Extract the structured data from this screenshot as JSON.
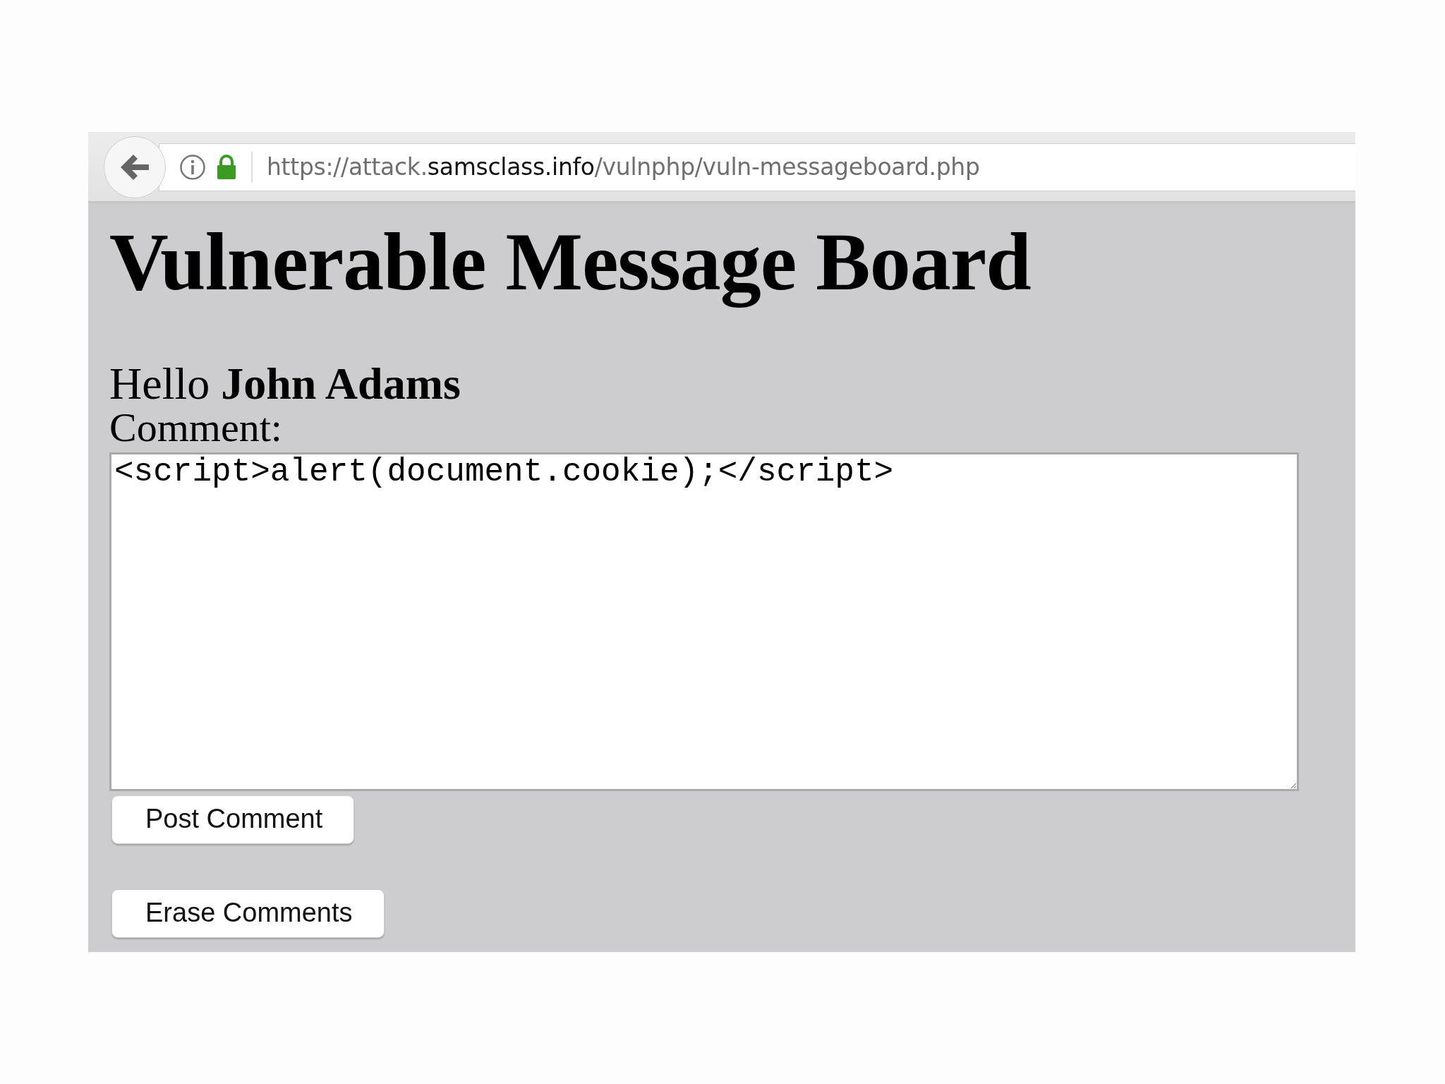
{
  "browser": {
    "url": "https://attack.**samsclass.info**/vulnphp/vuln-messageboard.php",
    "secure": true
  },
  "page": {
    "title": "Vulnerable Message Board",
    "greeting": "Hello **John Adams**",
    "comment_label": "Comment:",
    "comment_value": "<script>alert(document.cookie);</script>",
    "buttons": [
      {
        "label": "Post Comment"
      },
      {
        "label": "Erase Comments"
      }
    ]
  }
}
